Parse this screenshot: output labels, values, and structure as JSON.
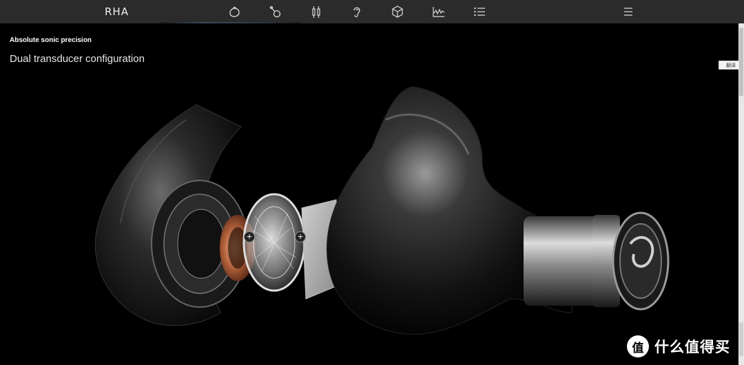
{
  "brand": {
    "logo": "RHA"
  },
  "nav": {
    "icons": [
      {
        "name": "shell-icon"
      },
      {
        "name": "earphone-icon"
      },
      {
        "name": "cable-icon"
      },
      {
        "name": "ear-icon"
      },
      {
        "name": "box-icon"
      },
      {
        "name": "graph-icon"
      },
      {
        "name": "list-icon"
      }
    ],
    "menu_icon": "hamburger-icon"
  },
  "hero": {
    "eyebrow": "Absolute sonic precision",
    "headline": "Dual transducer configuration"
  },
  "hotspots": [
    {
      "label": "+"
    },
    {
      "label": "+"
    }
  ],
  "translate_button": {
    "label": "翻译"
  },
  "watermark": {
    "badge": "值",
    "text": "什么值得买"
  },
  "colors": {
    "topbar": "#2b2b2b",
    "background": "#000000",
    "copper": "#b0603a"
  }
}
